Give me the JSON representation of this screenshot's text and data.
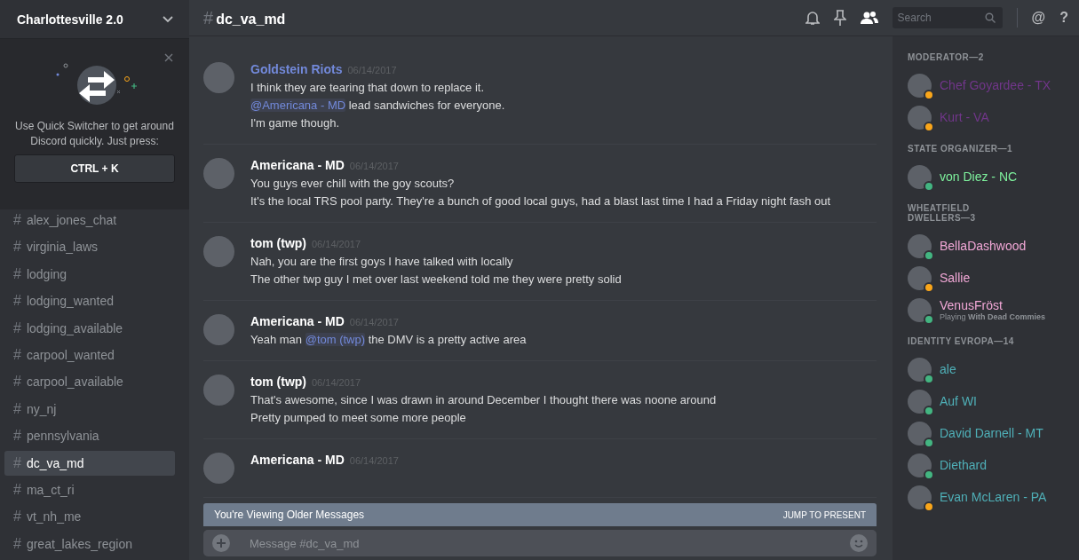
{
  "server": {
    "name": "Charlottesville 2.0"
  },
  "quick_switcher": {
    "text": "Use Quick Switcher to get around Discord quickly. Just press:",
    "shortcut": "CTRL + K"
  },
  "channels": [
    {
      "hash": "#",
      "name": "alex_jones_chat",
      "selected": false
    },
    {
      "hash": "#",
      "name": "virginia_laws",
      "selected": false
    },
    {
      "hash": "#",
      "name": "lodging",
      "selected": false
    },
    {
      "hash": "#",
      "name": "lodging_wanted",
      "selected": false
    },
    {
      "hash": "#",
      "name": "lodging_available",
      "selected": false
    },
    {
      "hash": "#",
      "name": "carpool_wanted",
      "selected": false
    },
    {
      "hash": "#",
      "name": "carpool_available",
      "selected": false
    },
    {
      "hash": "#",
      "name": "ny_nj",
      "selected": false
    },
    {
      "hash": "#",
      "name": "pennsylvania",
      "selected": false
    },
    {
      "hash": "#",
      "name": "dc_va_md",
      "selected": true
    },
    {
      "hash": "#",
      "name": "ma_ct_ri",
      "selected": false
    },
    {
      "hash": "#",
      "name": "vt_nh_me",
      "selected": false
    },
    {
      "hash": "#",
      "name": "great_lakes_region",
      "selected": false
    }
  ],
  "header": {
    "hash": "#",
    "channel": "dc_va_md",
    "search_placeholder": "Search",
    "at": "@",
    "help": "?"
  },
  "messages": [
    {
      "author": "Goldstein Riots",
      "color": "#7289da",
      "time": "06/14/2017",
      "lines": [
        [
          {
            "kind": "text",
            "text": "I think they are tearing that down to replace it."
          }
        ],
        [
          {
            "kind": "mention",
            "text": "@Americana - MD"
          },
          {
            "kind": "text",
            "text": " lead sandwiches for everyone."
          }
        ],
        [
          {
            "kind": "text",
            "text": "I'm game though."
          }
        ]
      ]
    },
    {
      "author": "Americana - MD",
      "color": "#ffffff",
      "time": "06/14/2017",
      "lines": [
        [
          {
            "kind": "text",
            "text": "You guys ever chill with the goy scouts?"
          }
        ],
        [
          {
            "kind": "text",
            "text": "It's the local TRS pool party. They're a bunch of good local guys, had a blast last time I had a Friday night fash out"
          }
        ]
      ]
    },
    {
      "author": "tom (twp)",
      "color": "#ffffff",
      "time": "06/14/2017",
      "lines": [
        [
          {
            "kind": "text",
            "text": "Nah, you are the first goys I have talked with locally"
          }
        ],
        [
          {
            "kind": "text",
            "text": "The other twp guy I met over last weekend told me they were pretty solid"
          }
        ]
      ]
    },
    {
      "author": "Americana - MD",
      "color": "#ffffff",
      "time": "06/14/2017",
      "lines": [
        [
          {
            "kind": "text",
            "text": "Yeah man "
          },
          {
            "kind": "mention",
            "text": "@tom (twp)"
          },
          {
            "kind": "text",
            "text": " the DMV is a pretty active area"
          }
        ]
      ]
    },
    {
      "author": "tom (twp)",
      "color": "#ffffff",
      "time": "06/14/2017",
      "lines": [
        [
          {
            "kind": "text",
            "text": "That's awesome, since I was drawn in around December I thought there was noone around"
          }
        ],
        [
          {
            "kind": "text",
            "text": "Pretty pumped to meet some more people"
          }
        ]
      ]
    },
    {
      "author": "Americana - MD",
      "color": "#ffffff",
      "time": "06/14/2017"
    }
  ],
  "older_banner": {
    "text": "You're Viewing Older Messages",
    "action": "JUMP TO PRESENT"
  },
  "composer": {
    "placeholder": "Message #dc_va_md"
  },
  "member_groups": [
    {
      "title": "MODERATOR—2",
      "members": [
        {
          "name": "Chef Goyardee - TX",
          "color": "#71368a",
          "idle": true
        },
        {
          "name": "Kurt - VA",
          "color": "#71368a",
          "idle": true
        }
      ]
    },
    {
      "title": "STATE ORGANIZER—1",
      "members": [
        {
          "name": "von Diez - NC",
          "color": "#7ef29d",
          "idle": false
        }
      ]
    },
    {
      "title": "WHEATFIELD DWELLERS—3",
      "members": [
        {
          "name": "BellaDashwood",
          "color": "#f1a7d6",
          "idle": false
        },
        {
          "name": "Sallie",
          "color": "#f1a7d6",
          "idle": true
        },
        {
          "name": "VenusFröst",
          "color": "#f1a7d6",
          "idle": false,
          "activity": "Playing **With Dead Commies**"
        }
      ]
    },
    {
      "title": "IDENTITY EVROPA—14",
      "members": [
        {
          "name": "ale",
          "color": "#4fb0b8",
          "idle": false
        },
        {
          "name": "Auf WI",
          "color": "#4fb0b8",
          "idle": false
        },
        {
          "name": "David Darnell - MT",
          "color": "#4fb0b8",
          "idle": false
        },
        {
          "name": "Diethard",
          "color": "#4fb0b8",
          "idle": false
        },
        {
          "name": "Evan McLaren - PA",
          "color": "#4fb0b8",
          "idle": true
        }
      ]
    }
  ]
}
